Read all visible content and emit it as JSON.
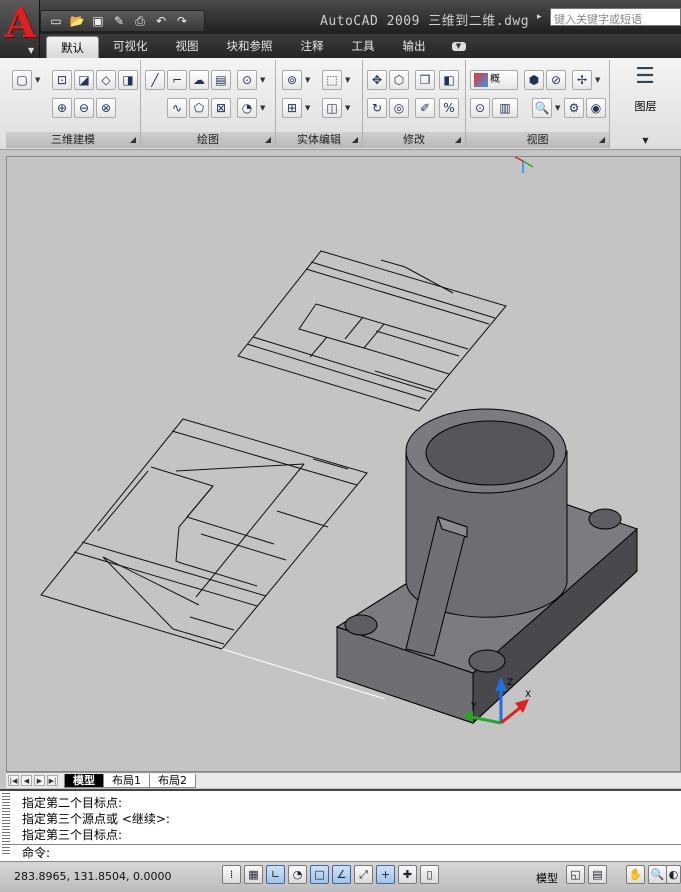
{
  "app": {
    "title": "AutoCAD 2009  三维到二维.dwg",
    "search_placeholder": "键入关键字或短语"
  },
  "colors": {
    "accent": "#e02020",
    "canvas": "#c4c4c4",
    "solid": "#6a6a70"
  },
  "quick_access": [
    "new-icon",
    "open-icon",
    "save-icon",
    "edit-icon",
    "print-icon",
    "undo-icon",
    "redo-icon"
  ],
  "tabs": [
    "默认",
    "可视化",
    "视图",
    "块和参照",
    "注释",
    "工具",
    "输出"
  ],
  "ribbon": {
    "panels": [
      {
        "title": "三维建模"
      },
      {
        "title": "绘图"
      },
      {
        "title": "实体编辑"
      },
      {
        "title": "修改"
      },
      {
        "title": "视图"
      },
      {
        "title": "图层"
      }
    ],
    "visual_style_label": "概",
    "layer_label": "图层"
  },
  "layout_tabs": [
    "模型",
    "布局1",
    "布局2"
  ],
  "command": {
    "history": [
      "指定第二个目标点:",
      "指定第三个源点或 <继续>:",
      "指定第三个目标点:"
    ],
    "prompt": "命令:"
  },
  "status": {
    "coords": "283.8965, 131.8504, 0.0000",
    "model_label": "模型"
  }
}
